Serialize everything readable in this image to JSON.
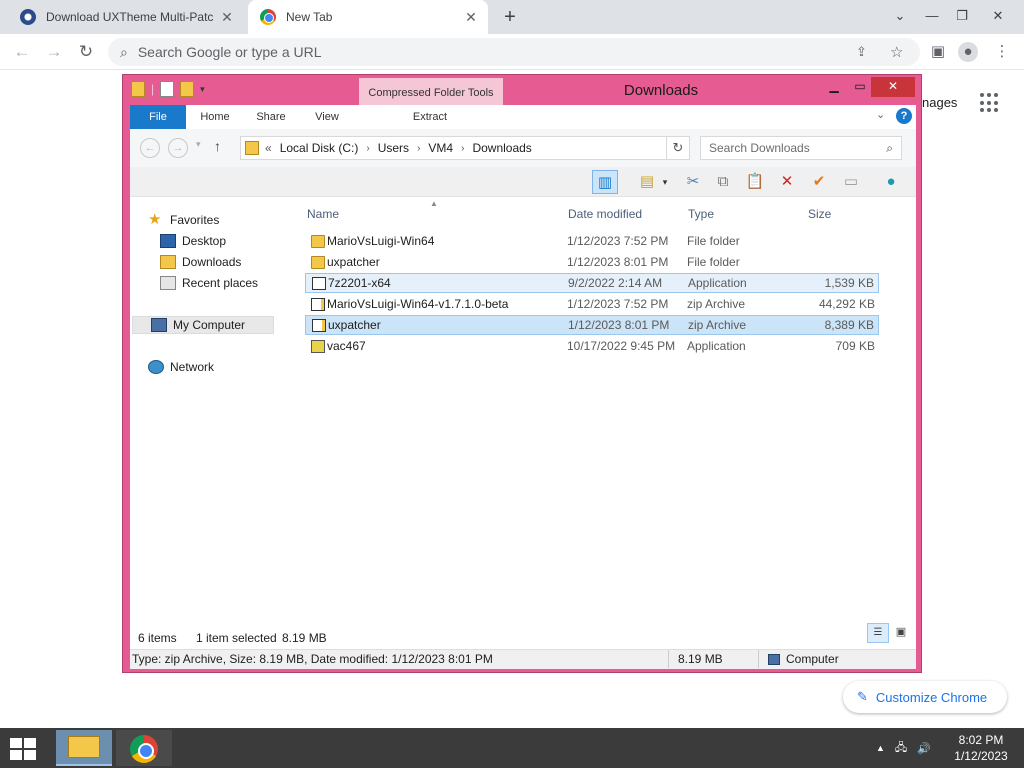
{
  "browser": {
    "tabs": [
      {
        "label": "Download UXTheme Multi-Patch",
        "favicon": "site-icon"
      },
      {
        "label": "New Tab",
        "favicon": "chrome-icon"
      }
    ],
    "omnibox_placeholder": "Search Google or type a URL",
    "images_link": "nages",
    "customize_label": "Customize Chrome"
  },
  "explorer": {
    "title": "Downloads",
    "context_tab": "Compressed Folder Tools",
    "ribbon_tabs": [
      "File",
      "Home",
      "Share",
      "View",
      "Extract"
    ],
    "breadcrumb": [
      "Local Disk (C:)",
      "Users",
      "VM4",
      "Downloads"
    ],
    "breadcrumb_prefix": "«",
    "search_placeholder": "Search Downloads",
    "nav": {
      "favorites": "Favorites",
      "desktop": "Desktop",
      "downloads": "Downloads",
      "recent": "Recent places",
      "my_computer": "My Computer",
      "network": "Network"
    },
    "columns": {
      "name": "Name",
      "date": "Date modified",
      "type": "Type",
      "size": "Size"
    },
    "files": [
      {
        "name": "MarioVsLuigi-Win64",
        "date": "1/12/2023 7:52 PM",
        "type": "File folder",
        "size": "",
        "icon": "folder-icon"
      },
      {
        "name": "uxpatcher",
        "date": "1/12/2023 8:01 PM",
        "type": "File folder",
        "size": "",
        "icon": "folder-icon"
      },
      {
        "name": "7z2201-x64",
        "date": "9/2/2022 2:14 AM",
        "type": "Application",
        "size": "1,539 KB",
        "icon": "7zip-icon"
      },
      {
        "name": "MarioVsLuigi-Win64-v1.7.1.0-beta",
        "date": "1/12/2023 7:52 PM",
        "type": "zip Archive",
        "size": "44,292 KB",
        "icon": "zip-icon"
      },
      {
        "name": "uxpatcher",
        "date": "1/12/2023 8:01 PM",
        "type": "zip Archive",
        "size": "8,389 KB",
        "icon": "zip-icon"
      },
      {
        "name": "vac467",
        "date": "10/17/2022 9:45 PM",
        "type": "Application",
        "size": "709 KB",
        "icon": "vac-icon"
      }
    ],
    "status": {
      "items": "6 items",
      "selected": "1 item selected",
      "selected_size": "8.19 MB"
    },
    "details": {
      "text": "Type: zip Archive, Size: 8.19 MB, Date modified: 1/12/2023 8:01 PM",
      "size": "8.19 MB",
      "location": "Computer"
    }
  },
  "taskbar": {
    "time": "8:02 PM",
    "date": "1/12/2023"
  },
  "colors": {
    "explorer_frame": "#e55b92",
    "file_tab": "#1979ca",
    "close_button": "#c7353a",
    "selection": "#e6f0fa",
    "taskbar": "#3b3b3b"
  }
}
